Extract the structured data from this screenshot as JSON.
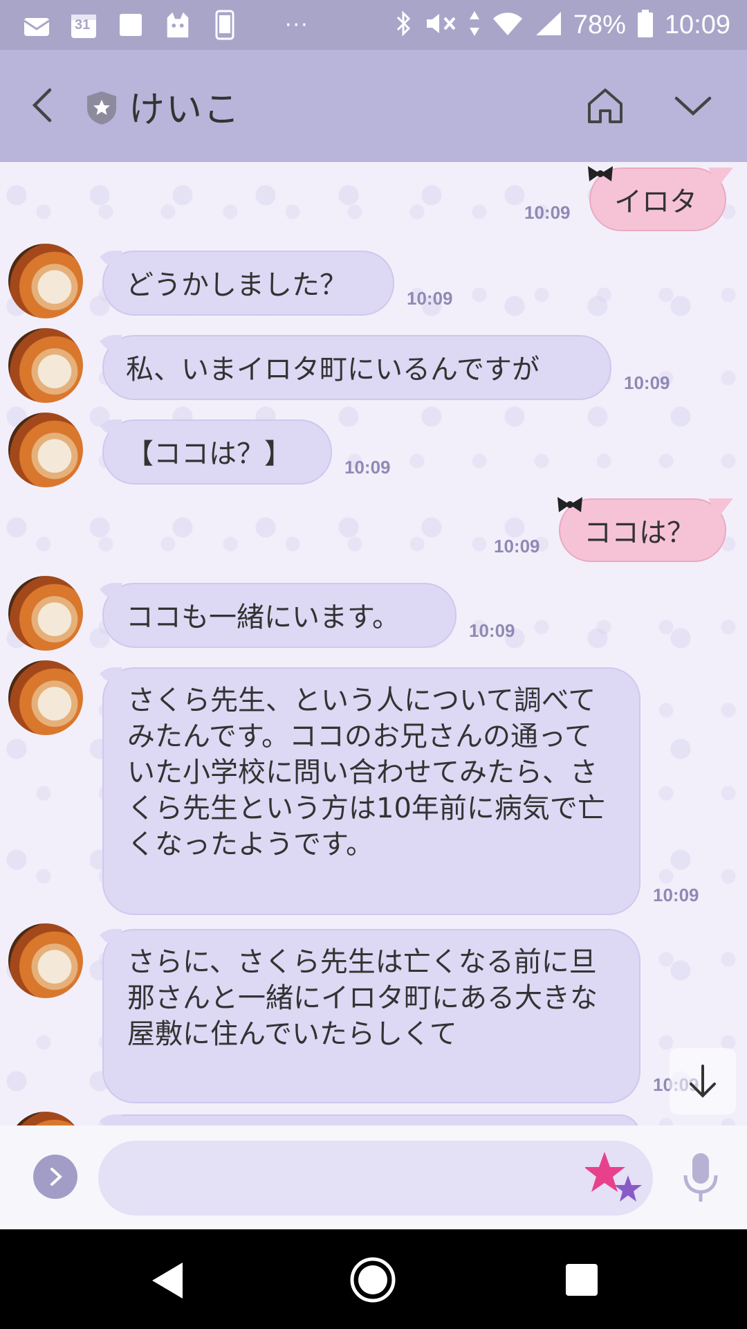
{
  "status_bar": {
    "battery": "78%",
    "time": "10:09",
    "calendar_day": "31",
    "overflow": "···"
  },
  "header": {
    "contact_name": "けいこ"
  },
  "messages": [
    {
      "side": "out",
      "text": "イロタ",
      "time": "10:09"
    },
    {
      "side": "in",
      "text": "どうかしました？",
      "time": "10:09"
    },
    {
      "side": "in",
      "text": "私、いまイロタ町にいるんですが",
      "time": "10:09"
    },
    {
      "side": "in",
      "text": "【ココは？】",
      "time": "10:09"
    },
    {
      "side": "out",
      "text": "ココは？",
      "time": "10:09"
    },
    {
      "side": "in",
      "text": "ココも一緒にいます。",
      "time": "10:09"
    },
    {
      "side": "in",
      "text": "さくら先生、という人について調べてみたんです。ココのお兄さんの通っていた小学校に問い合わせてみたら、さくら先生という方は10年前に病気で亡くなったようです。",
      "time": "10:09"
    },
    {
      "side": "in",
      "text": "さらに、さくら先生は亡くなる前に旦那さんと一緒にイロタ町にある大きな屋敷に住んでいたらしくて",
      "time": "10:09"
    }
  ],
  "input": {
    "placeholder": "",
    "value": ""
  },
  "colors": {
    "header_bg": "#b9b4d9",
    "status_bg": "#a9a5c9",
    "incoming_bubble": "#ddd8f4",
    "outgoing_bubble": "#f6c3d6",
    "time_text": "#8f8ab4"
  },
  "icons": [
    "back-icon",
    "shield-icon",
    "home-icon",
    "chevron-down-icon",
    "arrow-down-icon",
    "chevron-right-icon",
    "sticker-stars-icon",
    "mic-icon",
    "nav-back-icon",
    "nav-home-icon",
    "nav-recents-icon"
  ]
}
